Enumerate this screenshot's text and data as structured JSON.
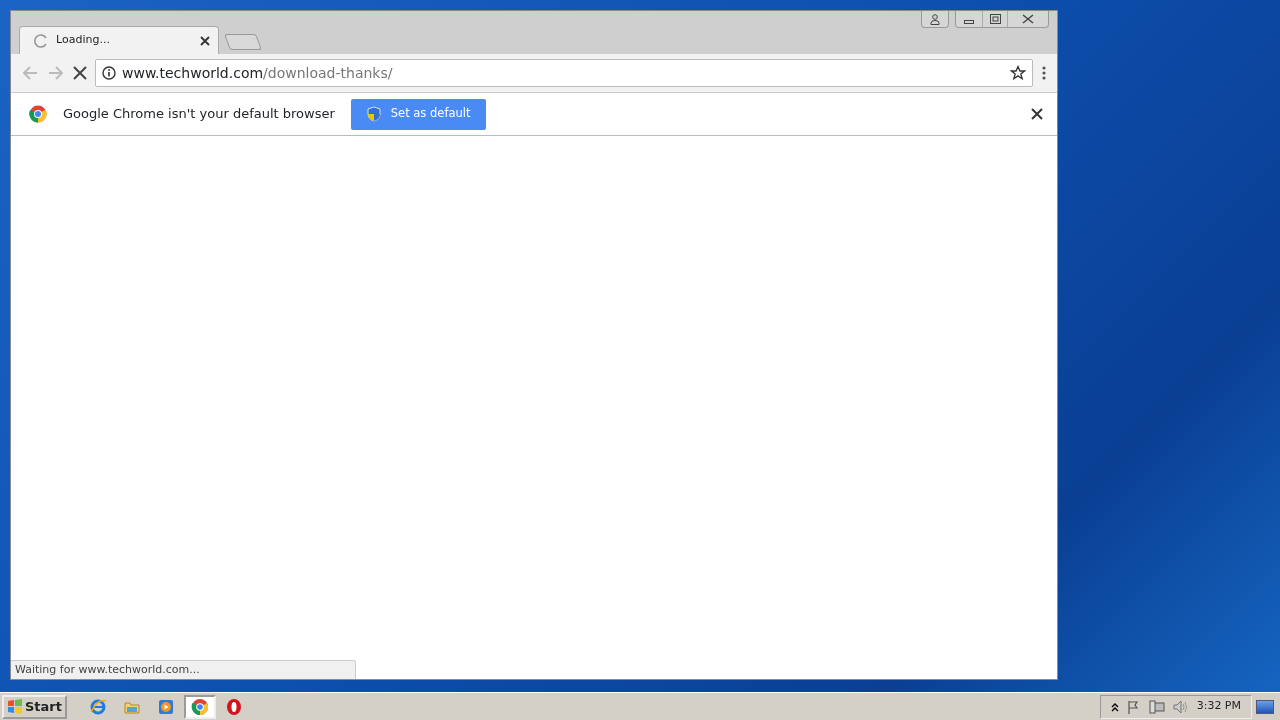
{
  "browser": {
    "tab_title": "Loading...",
    "address_host": "www.techworld.com",
    "address_path": "/download-thanks/"
  },
  "infobar": {
    "message": "Google Chrome isn't your default browser",
    "button": "Set as default"
  },
  "status_text": "Waiting for www.techworld.com...",
  "taskbar": {
    "start": "Start",
    "apps": [
      {
        "kind": "ie",
        "selected": false
      },
      {
        "kind": "folder",
        "selected": false
      },
      {
        "kind": "media",
        "selected": false
      },
      {
        "kind": "chrome",
        "selected": true
      },
      {
        "kind": "opera",
        "selected": false
      }
    ],
    "clock": "3:32 PM"
  }
}
